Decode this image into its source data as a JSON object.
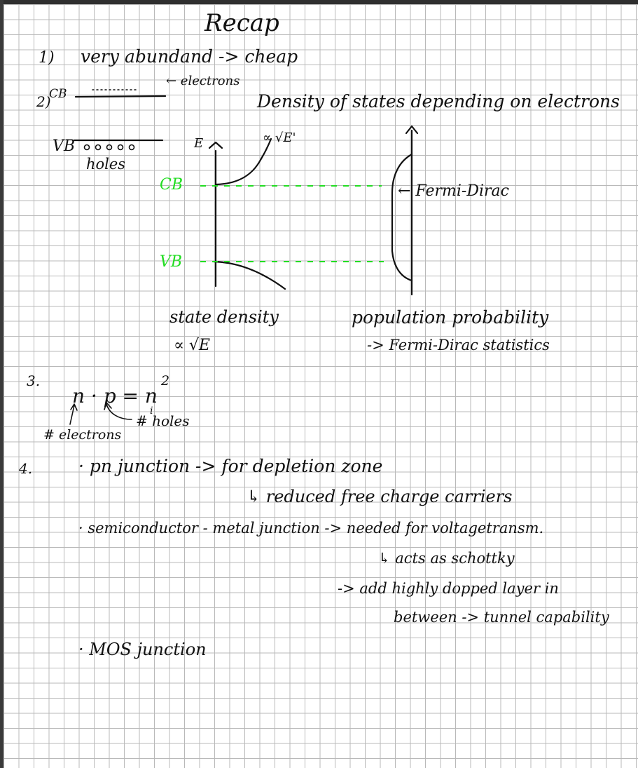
{
  "title": "Recap",
  "item1": {
    "number": "1)",
    "text": "very abundand -> cheap"
  },
  "item2": {
    "number": "2)",
    "cb_label": "CB",
    "electrons_label": "← electrons",
    "vb_label": "VB",
    "holes_label": "holes",
    "dos_heading": "Density of states depending on electrons",
    "axis_label": "E",
    "sqrt_label": "∝ √E'",
    "cb_level": "CB",
    "vb_level": "VB",
    "fermi_label": "← Fermi-Dirac",
    "state_density": "state density",
    "state_density_prop": "∝ √E",
    "population_probability": "population probability",
    "fermi_stats": "-> Fermi-Dirac statistics"
  },
  "item3": {
    "number": "3.",
    "equation": "n · p = n",
    "superscript": "2",
    "subscript": "i",
    "holes_note": "# holes",
    "electrons_note": "# electrons"
  },
  "item4": {
    "number": "4.",
    "pn_line": "·  pn junction -> for depletion zone",
    "pn_sub": "↳ reduced  free  charge  carriers",
    "sm_line": "·  semiconductor - metal junction ->  needed  for  voltagetransm.",
    "sm_sub1": "↳ acts  as  schottky",
    "sm_sub2": "-> add  highly  dopped  layer  in",
    "sm_sub3": "between -> tunnel  capability",
    "mos_line": "·  MOS  junction"
  },
  "colors": {
    "ink": "#111111",
    "green": "#22dd22",
    "grid": "#b9b9b9",
    "frame": "#2f2f2f"
  }
}
